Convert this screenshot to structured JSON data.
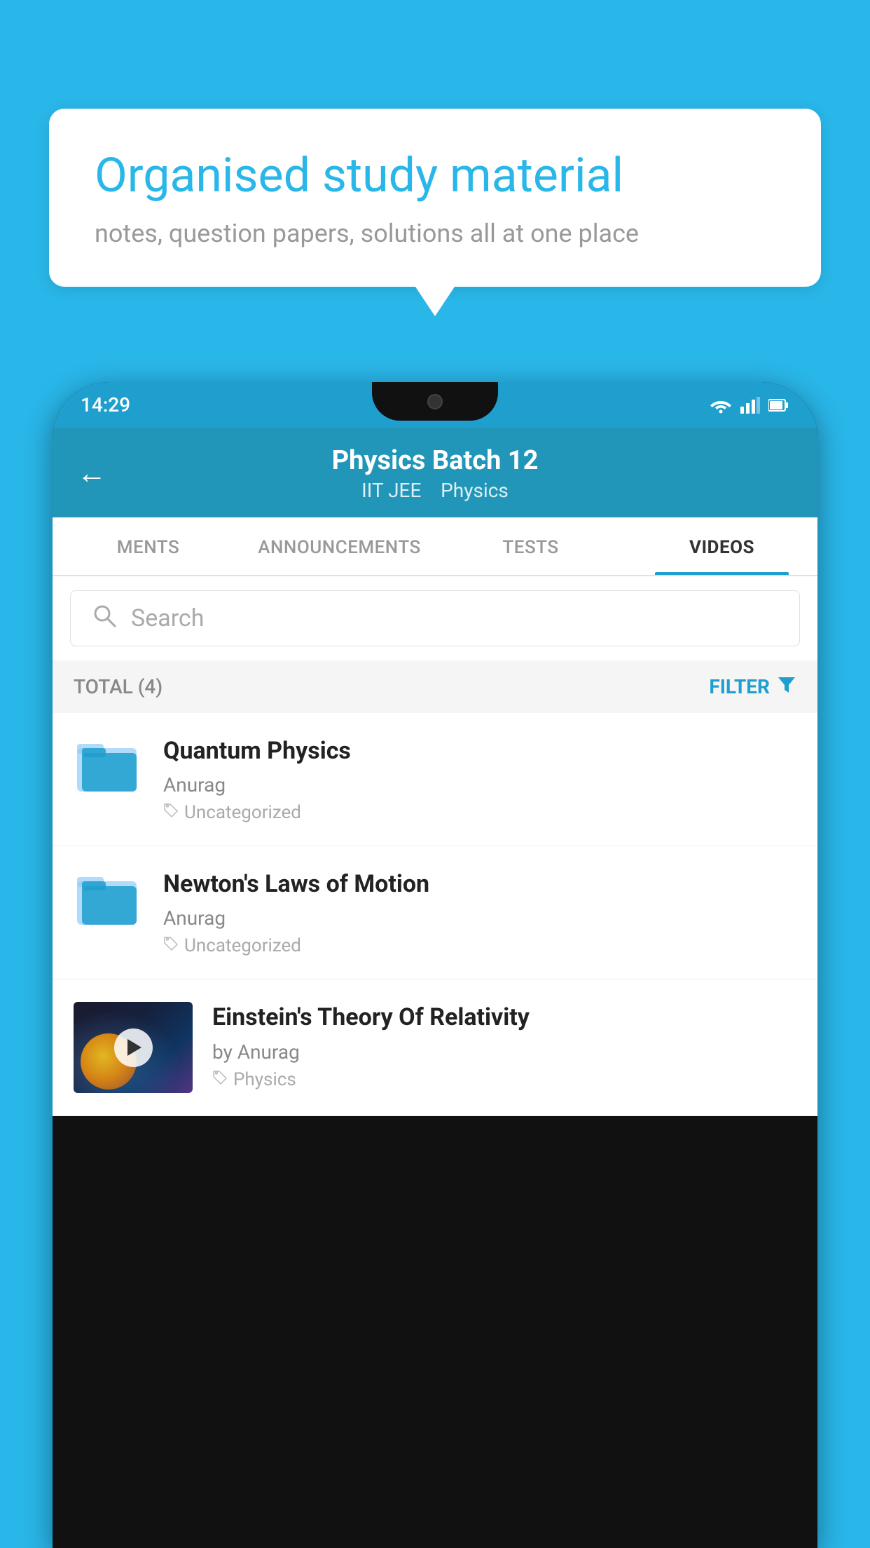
{
  "background_color": "#29b6e8",
  "bubble": {
    "title": "Organised study material",
    "subtitle": "notes, question papers, solutions all at one place"
  },
  "status_bar": {
    "time": "14:29",
    "icons": [
      "wifi",
      "signal",
      "battery"
    ]
  },
  "header": {
    "title": "Physics Batch 12",
    "subtitle_parts": [
      "IIT JEE",
      "Physics"
    ],
    "back_label": "←"
  },
  "tabs": [
    {
      "label": "MENTS",
      "active": false
    },
    {
      "label": "ANNOUNCEMENTS",
      "active": false
    },
    {
      "label": "TESTS",
      "active": false
    },
    {
      "label": "VIDEOS",
      "active": true
    }
  ],
  "search": {
    "placeholder": "Search"
  },
  "filter_bar": {
    "total_label": "TOTAL (4)",
    "filter_label": "FILTER"
  },
  "videos": [
    {
      "id": 1,
      "title": "Quantum Physics",
      "author": "Anurag",
      "tag": "Uncategorized",
      "type": "folder",
      "has_thumbnail": false
    },
    {
      "id": 2,
      "title": "Newton's Laws of Motion",
      "author": "Anurag",
      "tag": "Uncategorized",
      "type": "folder",
      "has_thumbnail": false
    },
    {
      "id": 3,
      "title": "Einstein's Theory Of Relativity",
      "author": "by Anurag",
      "tag": "Physics",
      "type": "video",
      "has_thumbnail": true
    }
  ]
}
